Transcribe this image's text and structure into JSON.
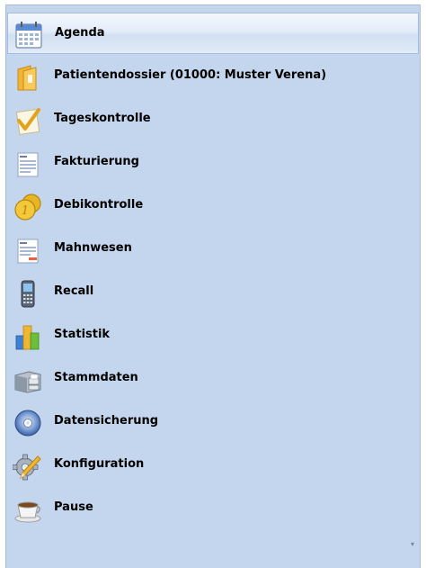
{
  "navigation": {
    "items": [
      {
        "label": "Agenda",
        "icon": "calendar-icon",
        "selected": true
      },
      {
        "label": "Patientendossier (01000: Muster Verena)",
        "icon": "folder-icon",
        "selected": false
      },
      {
        "label": "Tageskontrolle",
        "icon": "checklist-icon",
        "selected": false
      },
      {
        "label": "Fakturierung",
        "icon": "invoice-icon",
        "selected": false
      },
      {
        "label": "Debikontrolle",
        "icon": "coins-icon",
        "selected": false
      },
      {
        "label": "Mahnwesen",
        "icon": "reminder-document-icon",
        "selected": false
      },
      {
        "label": "Recall",
        "icon": "mobile-phone-icon",
        "selected": false
      },
      {
        "label": "Statistik",
        "icon": "bar-chart-icon",
        "selected": false
      },
      {
        "label": "Stammdaten",
        "icon": "drawer-cabinet-icon",
        "selected": false
      },
      {
        "label": "Datensicherung",
        "icon": "disc-icon",
        "selected": false
      },
      {
        "label": "Konfiguration",
        "icon": "gear-pencil-icon",
        "selected": false
      },
      {
        "label": "Pause",
        "icon": "coffee-cup-icon",
        "selected": false
      }
    ]
  },
  "scroll_indicator": "▾",
  "colors": {
    "panel_background": "#c4d6ed",
    "selected_background": "#e3ecf8",
    "selected_border": "#a3bde0"
  }
}
